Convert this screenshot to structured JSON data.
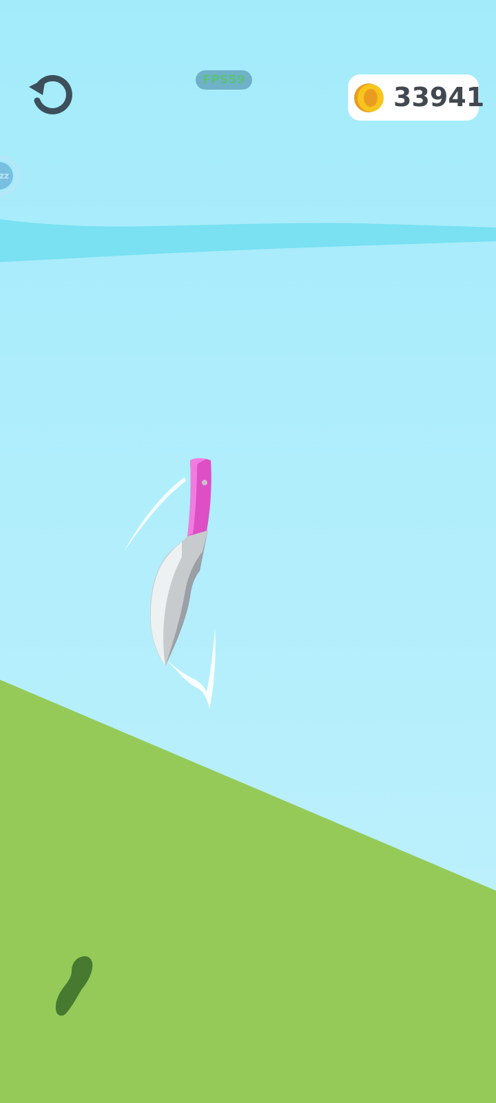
{
  "hud": {
    "fps_label": "FPS59",
    "coins": "33941",
    "side_badge_text": "zz"
  },
  "icons": {
    "restart": "restart-icon",
    "coin": "coin-icon",
    "knife": "knife-icon",
    "bush": "bush-icon"
  },
  "colors": {
    "sky_top": "#a3ebfb",
    "sky_bottom": "#c1f1fd",
    "horizon_band": "#79e1f1",
    "ground": "#95ca58",
    "bush": "#477a30",
    "restart_icon": "#3c4f5a",
    "fps_pill_bg": "#6fb1c8",
    "fps_text": "#5bc27d",
    "coin_panel_bg": "#ffffff",
    "coin_outer": "#f8c51c",
    "coin_inner": "#ea9c20",
    "coin_text": "#424850",
    "knife_handle": "#de4fc6",
    "knife_handle_light": "#f07ce0",
    "knife_blade": "#c7cbce",
    "knife_blade_light": "#eef1f2",
    "knife_blade_dark": "#9aa0a6",
    "side_badge_ring": "#b8e6f6",
    "side_badge_fill": "#78bfe0",
    "side_badge_text": "#bfe7f7"
  }
}
